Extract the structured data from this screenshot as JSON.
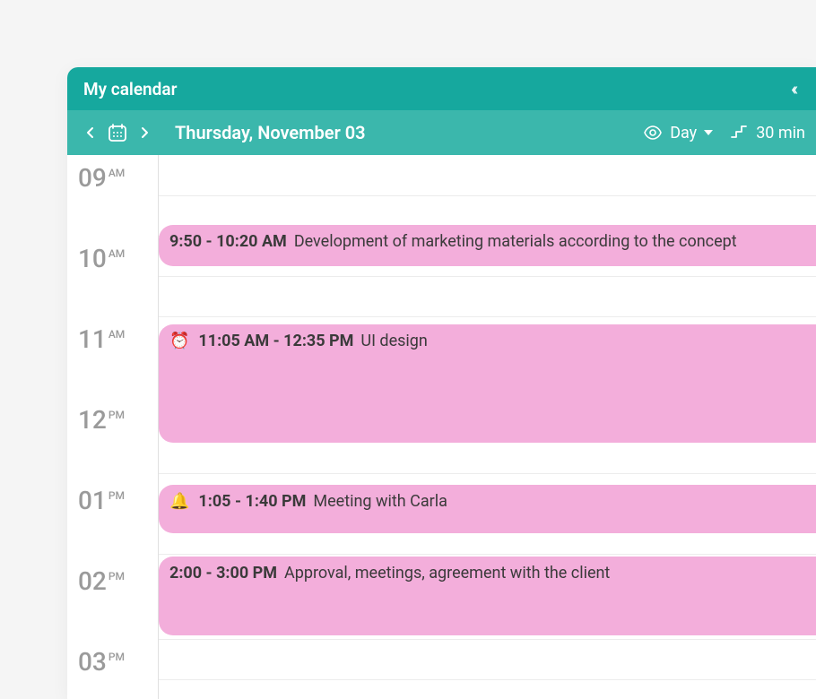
{
  "header": {
    "title": "My calendar"
  },
  "toolbar": {
    "date": "Thursday, November 03",
    "view_label": "Day",
    "interval_label": "30 min"
  },
  "time_slots": [
    {
      "hour": "09",
      "ampm": "AM"
    },
    {
      "hour": "10",
      "ampm": "AM"
    },
    {
      "hour": "11",
      "ampm": "AM"
    },
    {
      "hour": "12",
      "ampm": "PM"
    },
    {
      "hour": "01",
      "ampm": "PM"
    },
    {
      "hour": "02",
      "ampm": "PM"
    },
    {
      "hour": "03",
      "ampm": "PM"
    }
  ],
  "events": [
    {
      "time": "9:50 - 10:20 AM",
      "title": "Development of marketing materials according to the concept",
      "icon": ""
    },
    {
      "time": "11:05 AM - 12:35 PM",
      "title": "UI design",
      "icon": "⏰"
    },
    {
      "time": "1:05 - 1:40 PM",
      "title": "Meeting with Carla",
      "icon": "🔔"
    },
    {
      "time": "2:00 - 3:00 PM",
      "title": "Approval, meetings, agreement with the client",
      "icon": ""
    }
  ]
}
